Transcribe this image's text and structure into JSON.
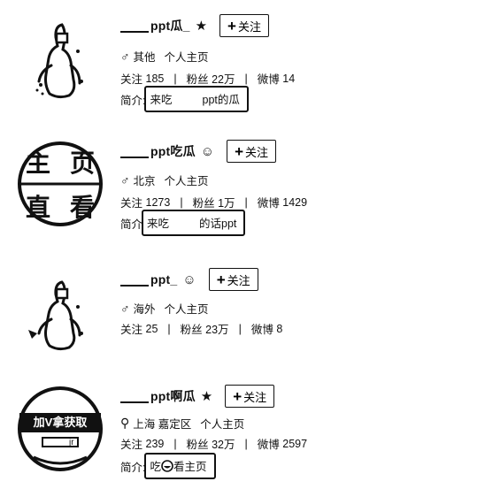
{
  "follow_label": "关注",
  "profiles": [
    {
      "name_suffix": "ppt瓜_",
      "badge": "★",
      "gender_icon": "♂",
      "location": "其他",
      "home_link": "个人主页",
      "stats": {
        "follow_label": "关注",
        "follow": "185",
        "fans_label": "粉丝",
        "fans": "22万",
        "weibo_label": "微博",
        "weibo": "14"
      },
      "bio_label": "简介:",
      "bio_a": "来吃",
      "bio_b": "ppt的瓜"
    },
    {
      "name_suffix": "ppt吃瓜",
      "badge": "☺",
      "gender_icon": "♂",
      "location": "北京",
      "home_link": "个人主页",
      "stats": {
        "follow_label": "关注",
        "follow": "1273",
        "fans_label": "粉丝",
        "fans": "1万",
        "weibo_label": "微博",
        "weibo": "1429"
      },
      "bio_label": "简介",
      "bio_a": "来吃",
      "bio_b": "的话ppt",
      "avatar_text": [
        "主",
        "页",
        "直",
        "看"
      ]
    },
    {
      "name_suffix": "ppt_",
      "badge": "☺",
      "gender_icon": "♂",
      "location": "海外",
      "home_link": "个人主页",
      "stats": {
        "follow_label": "关注",
        "follow": "25",
        "fans_label": "粉丝",
        "fans": "23万",
        "weibo_label": "微博",
        "weibo": "8"
      }
    },
    {
      "name_suffix": "ppt啊瓜",
      "badge": "★",
      "gender_icon": "⚲",
      "location": "上海 嘉定区",
      "home_link": "个人主页",
      "stats": {
        "follow_label": "关注",
        "follow": "239",
        "fans_label": "粉丝",
        "fans": "32万",
        "weibo_label": "微博",
        "weibo": "2597"
      },
      "bio_label": "简介:",
      "bio_a": "吃",
      "bio_b": "看主页",
      "avatar_text": "加V拿获取",
      "avatar_sub": "jr"
    }
  ]
}
